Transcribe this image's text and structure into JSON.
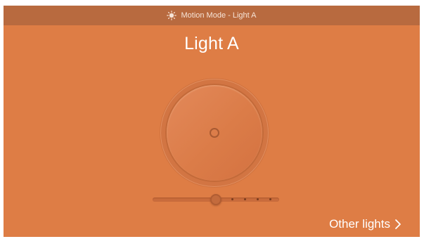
{
  "header": {
    "icon": "light-sun-icon",
    "title": "Motion Mode - Light A"
  },
  "main": {
    "light_name": "Light A",
    "slider": {
      "level_fraction": 0.5,
      "step_count": 5
    }
  },
  "footer": {
    "other_lights_label": "Other lights",
    "chevron_icon": "chevron-right-icon"
  },
  "colors": {
    "background": "#de7d45",
    "header_background": "#b86a3f",
    "text": "#ffffff"
  }
}
